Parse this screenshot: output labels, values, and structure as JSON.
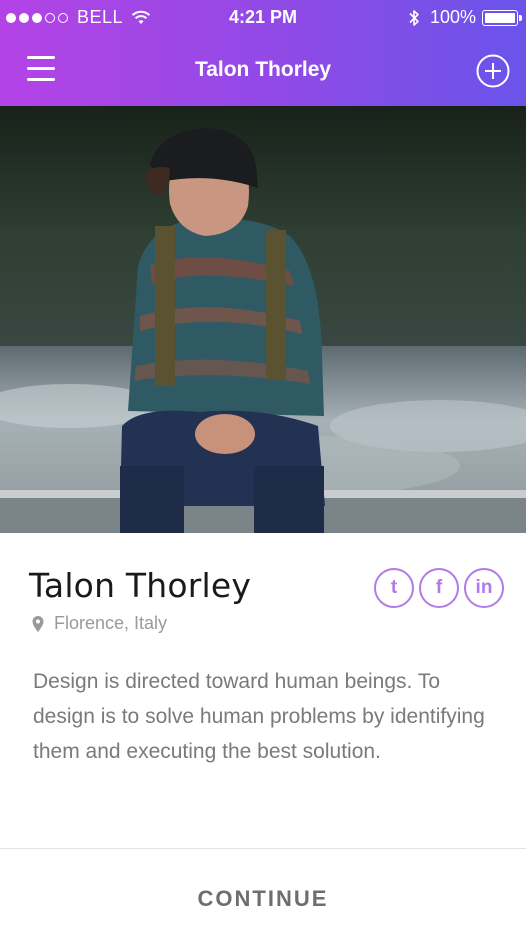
{
  "status_bar": {
    "carrier": "BELL",
    "time": "4:21 PM",
    "battery": "100%"
  },
  "nav": {
    "title": "Talon Thorley"
  },
  "profile": {
    "name": "Talon Thorley",
    "location": "Florence, Italy",
    "bio": "Design is directed toward human beings. To design is to solve human problems by identifying them and executing the best solution.",
    "socials": [
      {
        "icon": "twitter-icon",
        "glyph": "t"
      },
      {
        "icon": "facebook-icon",
        "glyph": "f"
      },
      {
        "icon": "linkedin-icon",
        "glyph": "in"
      }
    ]
  },
  "footer": {
    "continue_label": "CONTINUE"
  },
  "colors": {
    "header_gradient_start": "#b443e6",
    "header_gradient_end": "#6a54ea",
    "accent": "#b07be8"
  }
}
